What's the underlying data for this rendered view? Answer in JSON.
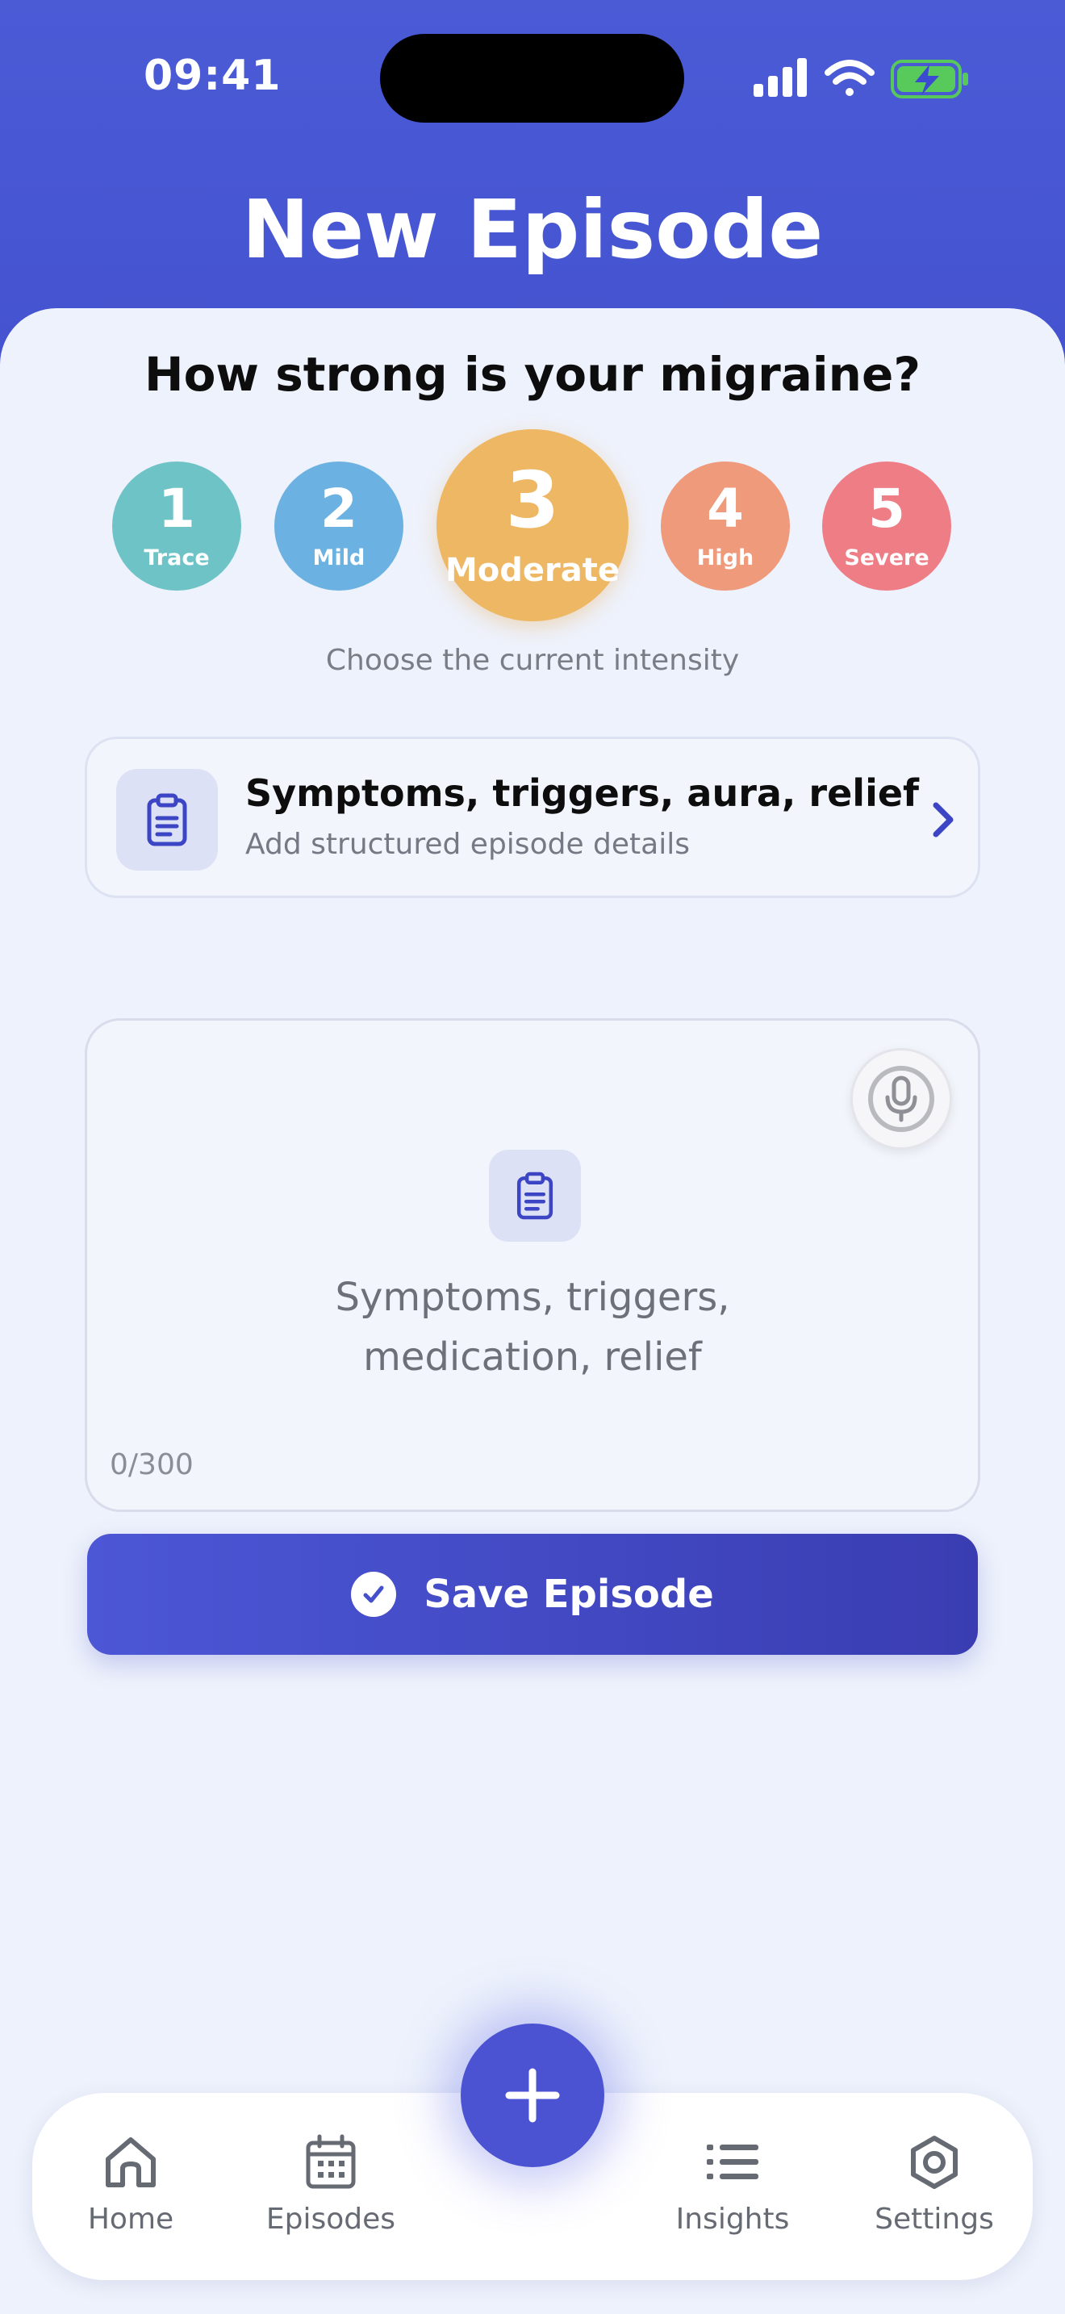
{
  "status_bar": {
    "time": "09:41",
    "icons": [
      "cellular-signal-icon",
      "wifi-icon",
      "battery-charging-icon"
    ]
  },
  "header": {
    "title": "New Episode"
  },
  "intensity": {
    "question": "How strong is your migraine?",
    "hint": "Choose the current intensity",
    "selected": 3,
    "levels": [
      {
        "number": "1",
        "label": "Trace",
        "color": "#6ec3c6"
      },
      {
        "number": "2",
        "label": "Mild",
        "color": "#6bb2e2"
      },
      {
        "number": "3",
        "label": "Moderate",
        "color": "#edb763"
      },
      {
        "number": "4",
        "label": "High",
        "color": "#ee9a7b"
      },
      {
        "number": "5",
        "label": "Severe",
        "color": "#ee7d86"
      }
    ]
  },
  "details": {
    "title": "Symptoms, triggers, aura, relief",
    "subtitle": "Add structured episode details",
    "icon": "clipboard-icon"
  },
  "notes": {
    "placeholder": "Symptoms, triggers,\nmedication, relief",
    "counter": "0/300",
    "icon": "clipboard-icon",
    "mic_icon": "microphone-icon"
  },
  "actions": {
    "save_label": "Save Episode"
  },
  "bottom_nav": {
    "items": [
      {
        "label": "Home",
        "icon": "home-icon"
      },
      {
        "label": "Episodes",
        "icon": "calendar-icon"
      },
      {
        "label": "Insights",
        "icon": "list-icon"
      },
      {
        "label": "Settings",
        "icon": "gear-icon"
      }
    ],
    "fab_icon": "plus-icon"
  },
  "colors": {
    "accent": "#4b53d3",
    "header_bg": "#4b5bd6",
    "background": "#eef2fc"
  }
}
